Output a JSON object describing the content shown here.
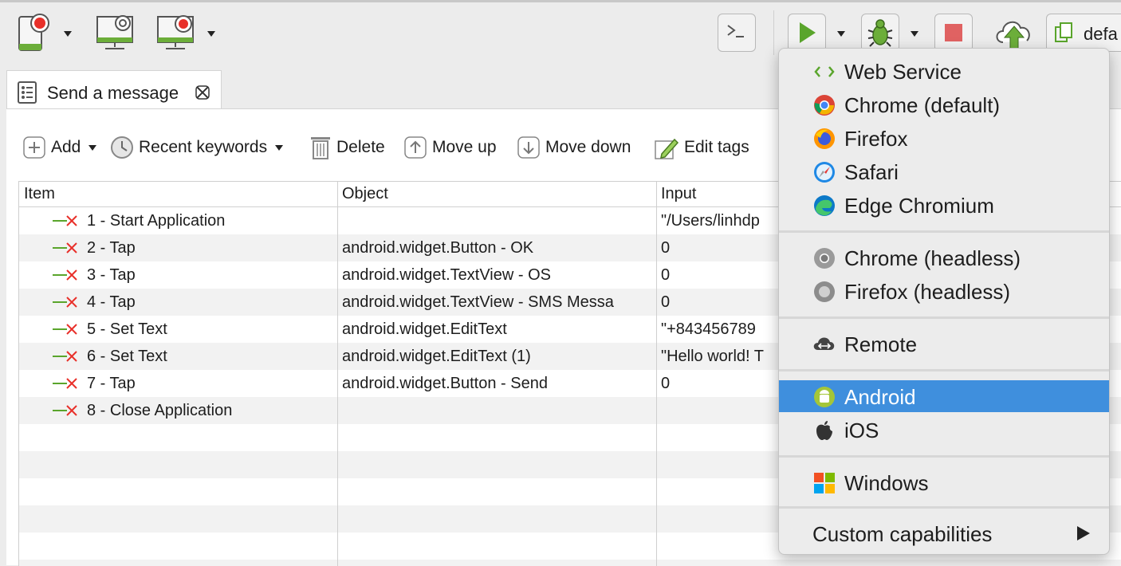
{
  "toolbar": {
    "run_config_text": "defa",
    "icons": [
      "record-mobile-icon",
      "spy-web-icon",
      "record-web-icon",
      "console-icon",
      "run-icon",
      "debug-icon",
      "stop-icon",
      "upload-icon",
      "copy-icon"
    ]
  },
  "editor": {
    "tab_title": "Send a message",
    "actions": {
      "add": "Add",
      "recent": "Recent keywords",
      "delete": "Delete",
      "move_up": "Move up",
      "move_down": "Move down",
      "edit_tags": "Edit tags",
      "overflow_char": "v"
    },
    "table": {
      "headers": [
        "Item",
        "Object",
        "Input"
      ],
      "rows": [
        {
          "item": "1 - Start Application",
          "object": "",
          "input": "\"/Users/linhdp"
        },
        {
          "item": "2 - Tap",
          "object": "android.widget.Button - OK",
          "input": "0"
        },
        {
          "item": "3 - Tap",
          "object": "android.widget.TextView - OS",
          "input": "0"
        },
        {
          "item": "4 - Tap",
          "object": "android.widget.TextView - SMS Messa",
          "input": "0"
        },
        {
          "item": "5 - Set Text",
          "object": "android.widget.EditText",
          "input": "\"+843456789"
        },
        {
          "item": "6 - Set Text",
          "object": "android.widget.EditText (1)",
          "input": "\"Hello world! T"
        },
        {
          "item": "7 - Tap",
          "object": "android.widget.Button - Send",
          "input": "0"
        },
        {
          "item": "8 - Close Application",
          "object": "",
          "input": ""
        }
      ]
    }
  },
  "menu": {
    "items": [
      {
        "label": "Web Service",
        "icon": "web-service-icon"
      },
      {
        "label": "Chrome (default)",
        "icon": "chrome-icon"
      },
      {
        "label": "Firefox",
        "icon": "firefox-icon"
      },
      {
        "label": "Safari",
        "icon": "safari-icon"
      },
      {
        "label": "Edge Chromium",
        "icon": "edge-icon"
      },
      {
        "label": "Chrome (headless)",
        "icon": "chrome-headless-icon"
      },
      {
        "label": "Firefox (headless)",
        "icon": "firefox-headless-icon"
      },
      {
        "label": "Remote",
        "icon": "remote-icon"
      },
      {
        "label": "Android",
        "icon": "android-icon",
        "selected": true
      },
      {
        "label": "iOS",
        "icon": "apple-icon"
      },
      {
        "label": "Windows",
        "icon": "windows-icon"
      },
      {
        "label": "Custom capabilities",
        "icon": "submenu-arrow-icon"
      }
    ]
  },
  "colors": {
    "selection": "#3f8fdd",
    "run_green": "#5aa52c",
    "record_red": "#e8302a",
    "stop_red": "#e06262"
  }
}
